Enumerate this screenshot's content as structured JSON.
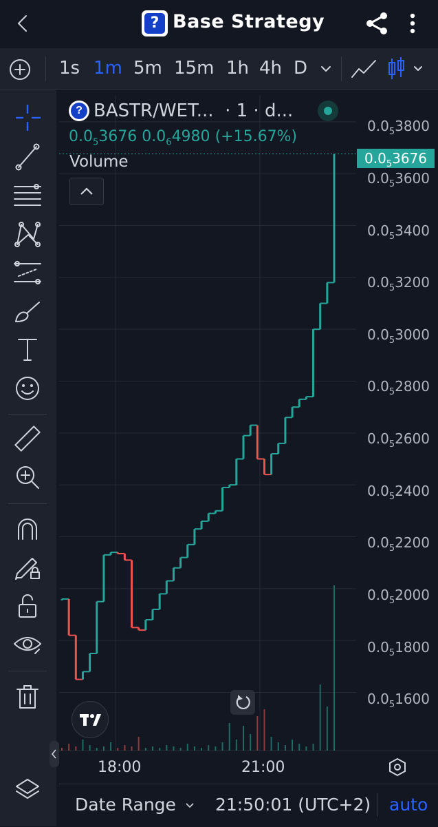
{
  "header": {
    "title": "Base Strategy",
    "logo_glyph": "?",
    "icons": [
      "back-arrow-icon",
      "share-icon",
      "more-vertical-icon"
    ]
  },
  "toolbar": {
    "timeframes": [
      "1s",
      "1m",
      "5m",
      "15m",
      "1h",
      "4h",
      "D"
    ],
    "active_timeframe": "1m",
    "icons": [
      "add-indicator-icon",
      "chevron-down-icon",
      "line-chart-icon",
      "candlestick-icon"
    ]
  },
  "left_tools": [
    "crosshair-icon",
    "trend-line-icon",
    "fib-retracement-icon",
    "pattern-icon",
    "parallel-channel-icon",
    "brush-icon",
    "text-icon",
    "emoji-icon",
    "ruler-icon",
    "zoom-in-icon",
    "magnet-icon",
    "lock-drawing-icon",
    "unlock-icon",
    "eye-icon",
    "trash-icon",
    "layers-icon"
  ],
  "legend": {
    "pair": "BASTR/WET...",
    "interval": "· 1 · d...",
    "open_main": "0.0",
    "open_sub": "5",
    "open_rest": "3676",
    "change_main": "0.0",
    "change_sub": "6",
    "change_rest": "4980",
    "change_pct": "(+15.67%)",
    "volume_label": "Volume"
  },
  "price_scale": {
    "labels": [
      {
        "main": "0.0",
        "sub": "5",
        "rest": "3800"
      },
      {
        "main": "0.0",
        "sub": "5",
        "rest": "3600"
      },
      {
        "main": "0.0",
        "sub": "5",
        "rest": "3400"
      },
      {
        "main": "0.0",
        "sub": "5",
        "rest": "3200"
      },
      {
        "main": "0.0",
        "sub": "5",
        "rest": "3000"
      },
      {
        "main": "0.0",
        "sub": "5",
        "rest": "2800"
      },
      {
        "main": "0.0",
        "sub": "5",
        "rest": "2600"
      },
      {
        "main": "0.0",
        "sub": "5",
        "rest": "2400"
      },
      {
        "main": "0.0",
        "sub": "5",
        "rest": "2200"
      },
      {
        "main": "0.0",
        "sub": "5",
        "rest": "2000"
      },
      {
        "main": "0.0",
        "sub": "5",
        "rest": "1800"
      },
      {
        "main": "0.0",
        "sub": "5",
        "rest": "1600"
      }
    ],
    "last_price_main": "0.0",
    "last_price_sub": "5",
    "last_price_rest": "3676"
  },
  "time_axis": {
    "labels": [
      "18:00",
      "21:00"
    ]
  },
  "bottom_bar": {
    "date_range": "Date Range",
    "clock": "21:50:01 (UTC+2)",
    "auto": "auto"
  },
  "colors": {
    "up": "#26a69a",
    "down": "#ef5350",
    "accent": "#2962ff",
    "background": "#131722"
  },
  "chart_data": {
    "type": "candlestick",
    "x_labels": [
      "18:00",
      "21:00"
    ],
    "ylim": [
      1450,
      3850
    ],
    "y_unit": "0.0₅ (×10⁻⁵)",
    "close_series": [
      {
        "t": 0,
        "c": 1960,
        "d": -1
      },
      {
        "t": 1,
        "c": 1820,
        "d": -1
      },
      {
        "t": 2,
        "c": 1650,
        "d": -1
      },
      {
        "t": 3,
        "c": 1680,
        "d": 1
      },
      {
        "t": 4,
        "c": 1750,
        "d": 1
      },
      {
        "t": 5,
        "c": 1950,
        "d": 1
      },
      {
        "t": 6,
        "c": 2130,
        "d": 1
      },
      {
        "t": 7,
        "c": 2140,
        "d": 1
      },
      {
        "t": 8,
        "c": 2135,
        "d": -1
      },
      {
        "t": 9,
        "c": 2110,
        "d": -1
      },
      {
        "t": 10,
        "c": 1850,
        "d": -1
      },
      {
        "t": 11,
        "c": 1840,
        "d": -1
      },
      {
        "t": 12,
        "c": 1880,
        "d": 1
      },
      {
        "t": 13,
        "c": 1920,
        "d": 1
      },
      {
        "t": 14,
        "c": 1980,
        "d": 1
      },
      {
        "t": 15,
        "c": 2030,
        "d": 1
      },
      {
        "t": 16,
        "c": 2080,
        "d": 1
      },
      {
        "t": 17,
        "c": 2120,
        "d": 1
      },
      {
        "t": 18,
        "c": 2170,
        "d": 1
      },
      {
        "t": 19,
        "c": 2230,
        "d": 1
      },
      {
        "t": 20,
        "c": 2260,
        "d": 1
      },
      {
        "t": 21,
        "c": 2290,
        "d": 1
      },
      {
        "t": 22,
        "c": 2300,
        "d": 1
      },
      {
        "t": 23,
        "c": 2390,
        "d": 1
      },
      {
        "t": 24,
        "c": 2400,
        "d": 1
      },
      {
        "t": 25,
        "c": 2500,
        "d": 1
      },
      {
        "t": 26,
        "c": 2590,
        "d": 1
      },
      {
        "t": 27,
        "c": 2630,
        "d": 1
      },
      {
        "t": 28,
        "c": 2500,
        "d": -1
      },
      {
        "t": 29,
        "c": 2440,
        "d": -1
      },
      {
        "t": 30,
        "c": 2520,
        "d": 1
      },
      {
        "t": 31,
        "c": 2560,
        "d": 1
      },
      {
        "t": 32,
        "c": 2660,
        "d": 1
      },
      {
        "t": 33,
        "c": 2700,
        "d": 1
      },
      {
        "t": 34,
        "c": 2730,
        "d": 1
      },
      {
        "t": 35,
        "c": 2740,
        "d": 1
      },
      {
        "t": 36,
        "c": 3000,
        "d": 1
      },
      {
        "t": 37,
        "c": 3100,
        "d": 1
      },
      {
        "t": 38,
        "c": 3180,
        "d": 1
      },
      {
        "t": 39,
        "c": 3676,
        "d": 1
      }
    ],
    "volume_bars": [
      2,
      5,
      3,
      8,
      4,
      2,
      3,
      6,
      2,
      4,
      3,
      10,
      2,
      3,
      2,
      4,
      3,
      2,
      5,
      3,
      2,
      4,
      3,
      6,
      20,
      8,
      18,
      12,
      25,
      30,
      10,
      6,
      4,
      8,
      5,
      3,
      5,
      48,
      32,
      120
    ],
    "title": "",
    "xlabel": "",
    "ylabel": ""
  }
}
